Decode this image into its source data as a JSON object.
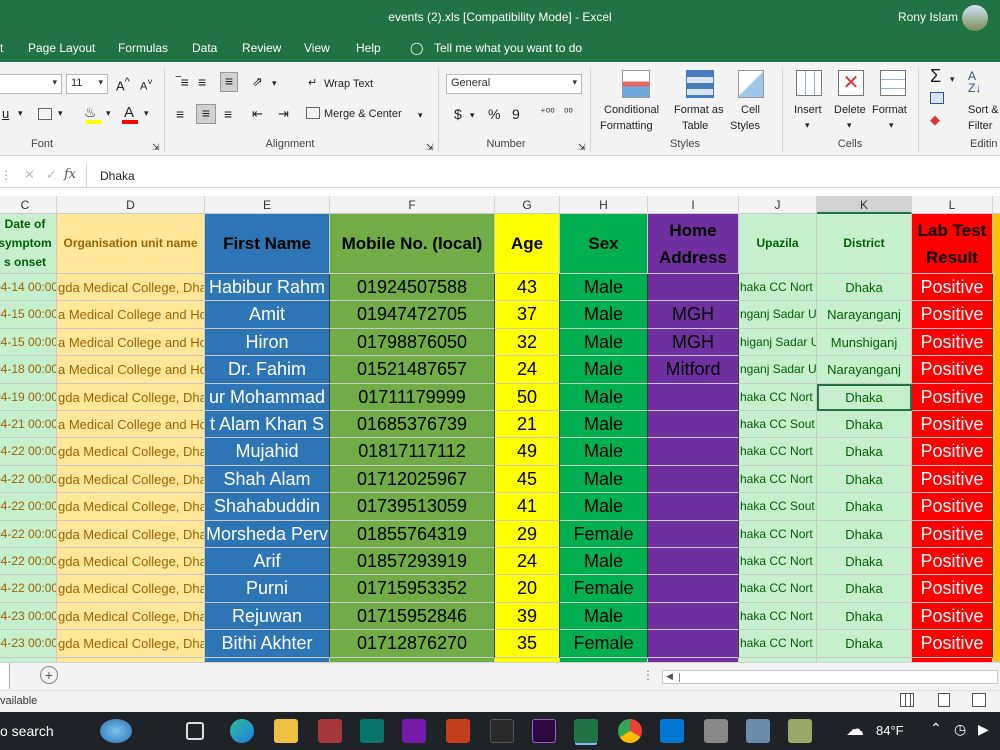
{
  "window": {
    "title": "events (2).xls  [Compatibility Mode]  -  Excel",
    "user": "Rony Islam"
  },
  "menu": [
    "t",
    "Page Layout",
    "Formulas",
    "Data",
    "Review",
    "View",
    "Help"
  ],
  "tell_me": "Tell me what you want to do",
  "ribbon": {
    "font_size": "11",
    "wrap_text": "Wrap Text",
    "merge_center": "Merge & Center",
    "number_format": "General",
    "currency": "$",
    "percent": "%",
    "comma": "9",
    "decimals_add": "⁺⁰⁰",
    "decimals_remove": "⁰⁰",
    "conditional_formatting": [
      "Conditional",
      "Formatting"
    ],
    "format_as_table": [
      "Format as",
      "Table"
    ],
    "cell_styles": [
      "Cell",
      "Styles"
    ],
    "insert": "Insert",
    "delete": "Delete",
    "format": "Format",
    "sort_filter": [
      "Sort &",
      "Filter"
    ],
    "groups": {
      "font": "Font",
      "alignment": "Alignment",
      "number": "Number",
      "styles": "Styles",
      "cells": "Cells",
      "editing": "Editin"
    }
  },
  "formula": {
    "value": "Dhaka"
  },
  "columns": [
    "C",
    "D",
    "E",
    "F",
    "G",
    "H",
    "I",
    "J",
    "K",
    "L"
  ],
  "headers": {
    "C": "Date of symptom s onset",
    "D": "Organisation unit name",
    "E": "First Name",
    "F": "Mobile No. (local)",
    "G": "Age",
    "H": "Sex",
    "I": "Home Address",
    "J": "Upazila",
    "K": "District",
    "L": "Lab Test Result"
  },
  "rows": [
    [
      "04-14 00:00",
      "gda Medical College, Dha",
      "Habibur Rahm",
      "01924507588",
      "43",
      "Male",
      "",
      "haka CC Nort",
      "Dhaka",
      "Positive"
    ],
    [
      "04-15 00:00",
      "a Medical College and Ho",
      "Amit",
      "01947472705",
      "37",
      "Male",
      "MGH",
      "nganj Sadar U",
      "Narayanganj",
      "Positive"
    ],
    [
      "04-15 00:00",
      "a Medical College and Ho",
      "Hiron",
      "01798876050",
      "32",
      "Male",
      "MGH",
      "higanj Sadar U",
      "Munshiganj",
      "Positive"
    ],
    [
      "04-18 00:00",
      "a Medical College and Ho",
      "Dr. Fahim",
      "01521487657",
      "24",
      "Male",
      "Mitford",
      "nganj Sadar U",
      "Narayanganj",
      "Positive"
    ],
    [
      "04-19 00:00",
      "gda Medical College, Dha",
      "ur Mohammad",
      "01711179999",
      "50",
      "Male",
      "",
      "haka CC Nort",
      "Dhaka",
      "Positive"
    ],
    [
      "04-21 00:00",
      "a Medical College and Ho",
      "t Alam Khan S",
      "01685376739",
      "21",
      "Male",
      "",
      "haka CC Sout",
      "Dhaka",
      "Positive"
    ],
    [
      "04-22 00:00",
      "gda Medical College, Dha",
      "Mujahid",
      "01817117112",
      "49",
      "Male",
      "",
      "haka CC Nort",
      "Dhaka",
      "Positive"
    ],
    [
      "04-22 00:00",
      "gda Medical College, Dha",
      "Shah Alam",
      "01712025967",
      "45",
      "Male",
      "",
      "haka CC Nort",
      "Dhaka",
      "Positive"
    ],
    [
      "04-22 00:00",
      "gda Medical College, Dha",
      "Shahabuddin",
      "01739513059",
      "41",
      "Male",
      "",
      "haka CC Sout",
      "Dhaka",
      "Positive"
    ],
    [
      "04-22 00:00",
      "gda Medical College, Dha",
      "Morsheda Perv",
      "01855764319",
      "29",
      "Female",
      "",
      "haka CC Nort",
      "Dhaka",
      "Positive"
    ],
    [
      "04-22 00:00",
      "gda Medical College, Dha",
      "Arif",
      "01857293919",
      "24",
      "Male",
      "",
      "haka CC Nort",
      "Dhaka",
      "Positive"
    ],
    [
      "04-22 00:00",
      "gda Medical College, Dha",
      "Purni",
      "01715953352",
      "20",
      "Female",
      "",
      "haka CC Nort",
      "Dhaka",
      "Positive"
    ],
    [
      "04-23 00:00",
      "gda Medical College, Dha",
      "Rejuwan",
      "01715952846",
      "39",
      "Male",
      "",
      "haka CC Nort",
      "Dhaka",
      "Positive"
    ],
    [
      "04-23 00:00",
      "gda Medical College, Dha",
      "Bithi Akhter",
      "01712876270",
      "35",
      "Female",
      "",
      "haka CC Nort",
      "Dhaka",
      "Positive"
    ]
  ],
  "status": {
    "text": "vailable"
  },
  "taskbar": {
    "search": "o search",
    "weather": "84°F"
  },
  "colors": {
    "excel_green": "#217346",
    "col_c": "#c6efce",
    "col_d": "#ffe699",
    "col_e": "#2e75b6",
    "col_f": "#70ad47",
    "col_g": "#ffff00",
    "col_h": "#00b050",
    "col_i": "#7030a0",
    "col_j": "#c6efce",
    "col_k": "#c6efce",
    "col_l": "#ff0000"
  }
}
